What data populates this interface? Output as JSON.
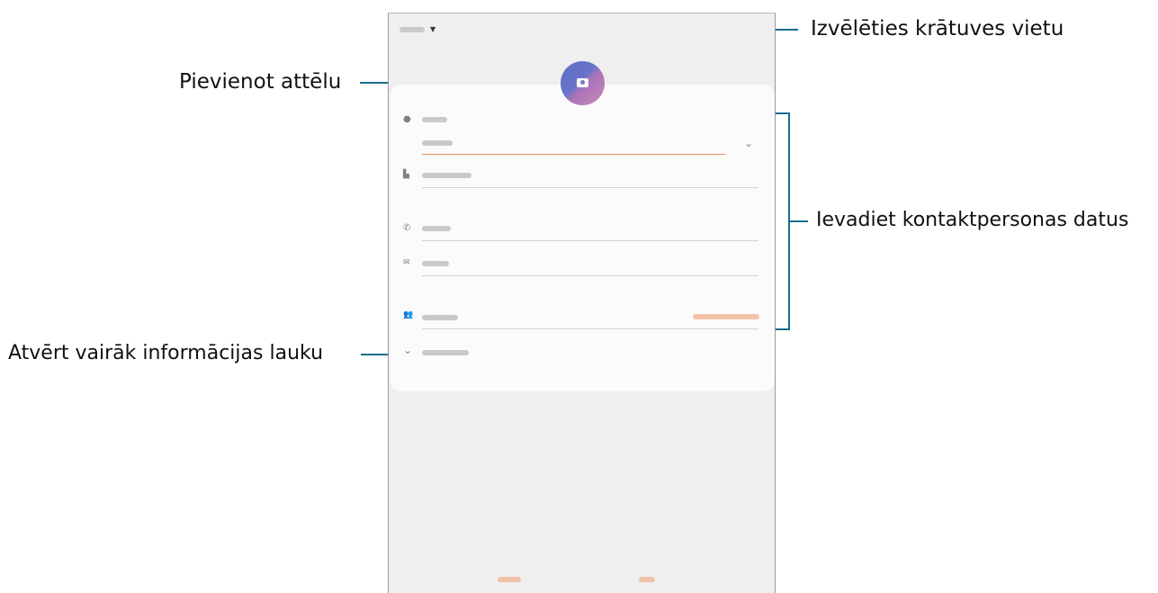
{
  "callouts": {
    "storage": "Izvēlēties krātuves vietu",
    "picture": "Pievienot attēlu",
    "details": "Ievadiet kontaktpersonas datus",
    "more": "Atvērt vairāk informācijas lauku"
  },
  "form": {
    "storage_label": "",
    "name_label": "",
    "name_value": "",
    "company_placeholder": "",
    "phone_placeholder": "",
    "email_placeholder": "",
    "groups_placeholder": "",
    "groups_action": "",
    "more_label": "",
    "cancel_label": "",
    "save_label": ""
  },
  "icons": {
    "storage_dropdown": "caret-down-icon",
    "add_picture": "camera-icon",
    "name": "person-icon",
    "name_expand": "chevron-down-icon",
    "company": "building-icon",
    "phone": "phone-icon",
    "email": "envelope-icon",
    "groups": "people-icon",
    "more": "chevron-down-icon"
  },
  "colors": {
    "callout_line": "#1b6d8e",
    "active_underline": "#e8895a",
    "avatar_gradient": [
      "#5c6cc4",
      "#c98ab8"
    ]
  }
}
